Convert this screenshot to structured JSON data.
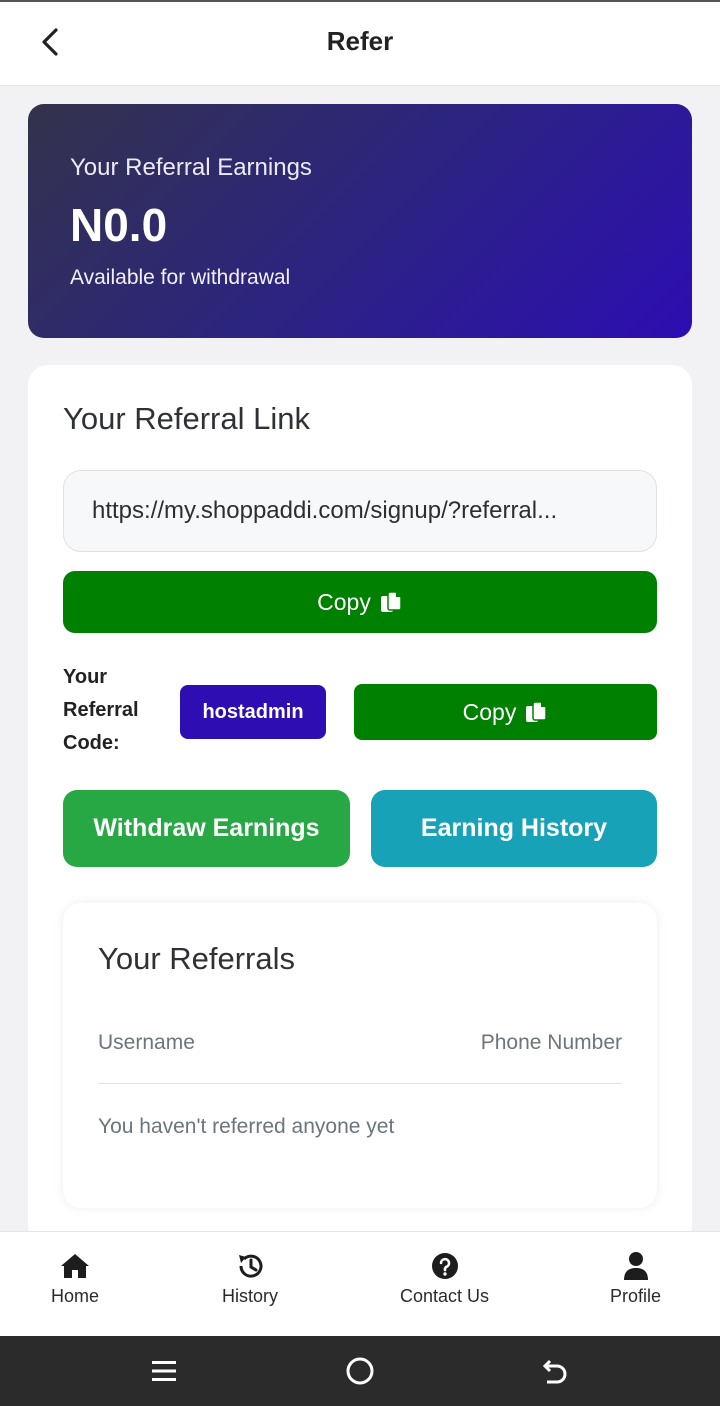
{
  "header": {
    "title": "Refer"
  },
  "earnings": {
    "label": "Your Referral Earnings",
    "amount": "N0.0",
    "sublabel": "Available for withdrawal"
  },
  "referral_link": {
    "title": "Your Referral Link",
    "url": "https://my.shoppaddi.com/signup/?referral...",
    "copy_label": "Copy"
  },
  "referral_code": {
    "label": "Your Referral Code:",
    "code": "hostadmin",
    "copy_label": "Copy"
  },
  "actions": {
    "withdraw_label": "Withdraw Earnings",
    "history_label": "Earning History"
  },
  "referrals": {
    "title": "Your Referrals",
    "columns": [
      "Username",
      "Phone Number"
    ],
    "empty_message": "You haven't referred anyone yet"
  },
  "bottom_nav": {
    "items": [
      {
        "label": "Home",
        "icon": "home-icon"
      },
      {
        "label": "History",
        "icon": "history-icon"
      },
      {
        "label": "Contact Us",
        "icon": "help-circle-icon"
      },
      {
        "label": "Profile",
        "icon": "user-icon"
      }
    ]
  },
  "colors": {
    "primary_green": "#008000",
    "success_green": "#28a745",
    "info_teal": "#17a2b8",
    "code_badge": "#2e0db3"
  }
}
